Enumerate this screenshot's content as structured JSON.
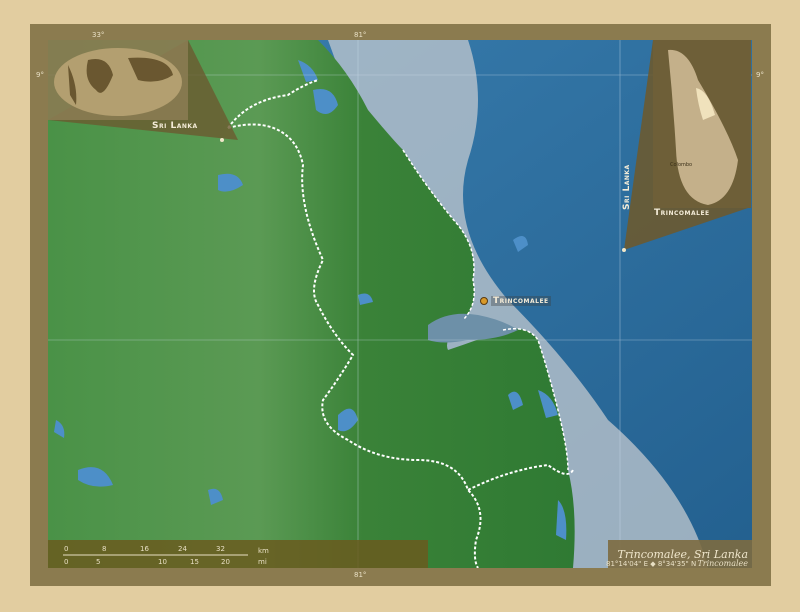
{
  "map": {
    "title": "Trincomalee, Sri Lanka",
    "subtitle": "Trincomalee",
    "coordinates": "81°14'04\" E ◆ 8°34'35\" N",
    "city_label": "Trincomalee",
    "inset_world_label": "Sri Lanka",
    "inset_country_label": "Sri Lanka",
    "inset_region_label": "Trincomalee",
    "inset_capital_label": "Colombo",
    "grid_labels": {
      "lon_top": "81°",
      "lon_bottom": "81°",
      "lat_left": "9°",
      "lat_right": "9°",
      "lon_inset": "33°"
    },
    "scale": {
      "top_ticks": [
        "0",
        "8",
        "16",
        "24",
        "32"
      ],
      "top_unit": "km",
      "bottom_ticks": [
        "0",
        "5",
        "10",
        "15",
        "20"
      ],
      "bottom_unit": "mi"
    },
    "colors": {
      "land": "#3f8a3c",
      "sea": "#2f6fa0",
      "frame": "#8b7b4f",
      "background": "#e2cda0"
    }
  }
}
